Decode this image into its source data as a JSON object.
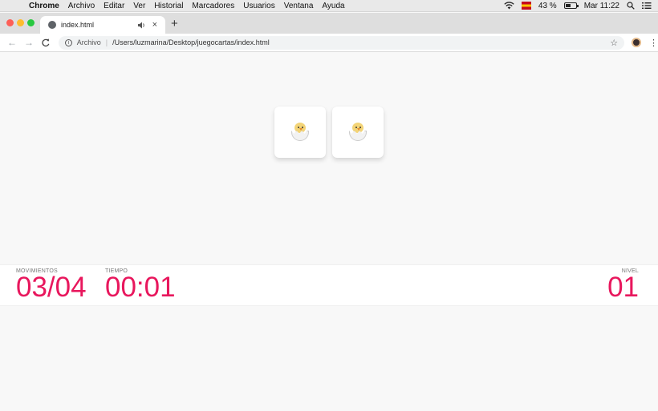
{
  "menubar": {
    "app": "Chrome",
    "items": [
      "Archivo",
      "Editar",
      "Ver",
      "Historial",
      "Marcadores",
      "Usuarios",
      "Ventana",
      "Ayuda"
    ],
    "battery": "43 %",
    "clock": "Mar 11:22",
    "icons": [
      "apple-icon",
      "wifi-icon",
      "flag-icon",
      "battery-icon",
      "search-icon",
      "list-icon"
    ]
  },
  "tab": {
    "title": "index.html",
    "audio_icon": "speaker-icon",
    "close": "×",
    "new_tab": "+"
  },
  "toolbar": {
    "back": "←",
    "forward": "→",
    "reload": "C",
    "info": "i",
    "scheme": "Archivo",
    "separator": "|",
    "url": "/Users/luzmarina/Desktop/juegocartas/index.html",
    "star": "☆",
    "menu": "⋮"
  },
  "cards": [
    {
      "icon": "hatching-chick-icon"
    },
    {
      "icon": "hatching-chick-icon"
    }
  ],
  "stats": {
    "moves_label": "MOVIMIENTOS",
    "moves_value": "03/04",
    "time_label": "TIEMPO",
    "time_value": "00:01",
    "level_label": "NIVEL",
    "level_value": "01",
    "accent": "#e8175d"
  }
}
